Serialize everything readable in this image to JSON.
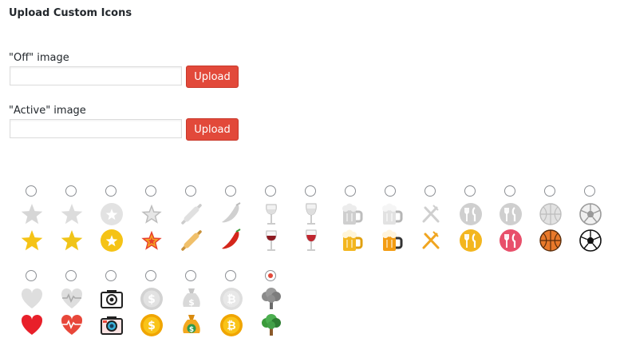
{
  "section": {
    "title": "Upload Custom Icons"
  },
  "off_image": {
    "label": "\"Off\" image",
    "value": "",
    "button": "Upload"
  },
  "active_image": {
    "label": "\"Active\" image",
    "value": "",
    "button": "Upload"
  },
  "colors": {
    "accent": "#e2493a",
    "gray": "#d6d6d6",
    "gold": "#f5c316",
    "red": "#e82a2a"
  },
  "icon_options": [
    {
      "name": "star",
      "selected": false
    },
    {
      "name": "star-flat",
      "selected": false
    },
    {
      "name": "star-circle",
      "selected": false
    },
    {
      "name": "star-small",
      "selected": false
    },
    {
      "name": "rolling-pin",
      "selected": false
    },
    {
      "name": "chili-pepper",
      "selected": false
    },
    {
      "name": "wine-glass",
      "selected": false
    },
    {
      "name": "wine-glass-tall",
      "selected": false
    },
    {
      "name": "beer-mug",
      "selected": false
    },
    {
      "name": "beer-mug-outline",
      "selected": false
    },
    {
      "name": "fork-knife-crossed",
      "selected": false
    },
    {
      "name": "restaurant-gold",
      "selected": false
    },
    {
      "name": "restaurant-red",
      "selected": false
    },
    {
      "name": "basketball",
      "selected": false
    },
    {
      "name": "soccer-ball",
      "selected": false
    },
    {
      "name": "heart",
      "selected": false
    },
    {
      "name": "heart-pulse",
      "selected": false
    },
    {
      "name": "camera",
      "selected": false
    },
    {
      "name": "dollar-coin",
      "selected": false
    },
    {
      "name": "money-bag",
      "selected": false
    },
    {
      "name": "bitcoin",
      "selected": false
    },
    {
      "name": "tree",
      "selected": true
    }
  ]
}
